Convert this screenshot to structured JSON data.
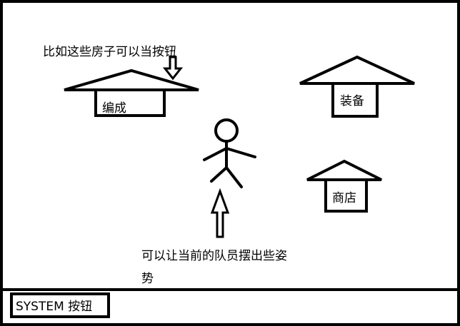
{
  "annotations": {
    "houses_note": "比如这些房子可以当按钮",
    "character_note_line1": "可以让当前的队员摆出些姿",
    "character_note_line2": "势"
  },
  "houses": {
    "formation_label": "编成",
    "equipment_label": "装备",
    "shop_label": "商店"
  },
  "bottom_bar": {
    "system_button_label": "SYSTEM 按钮"
  },
  "colors": {
    "ink": "#000000",
    "background": "#ffffff"
  }
}
